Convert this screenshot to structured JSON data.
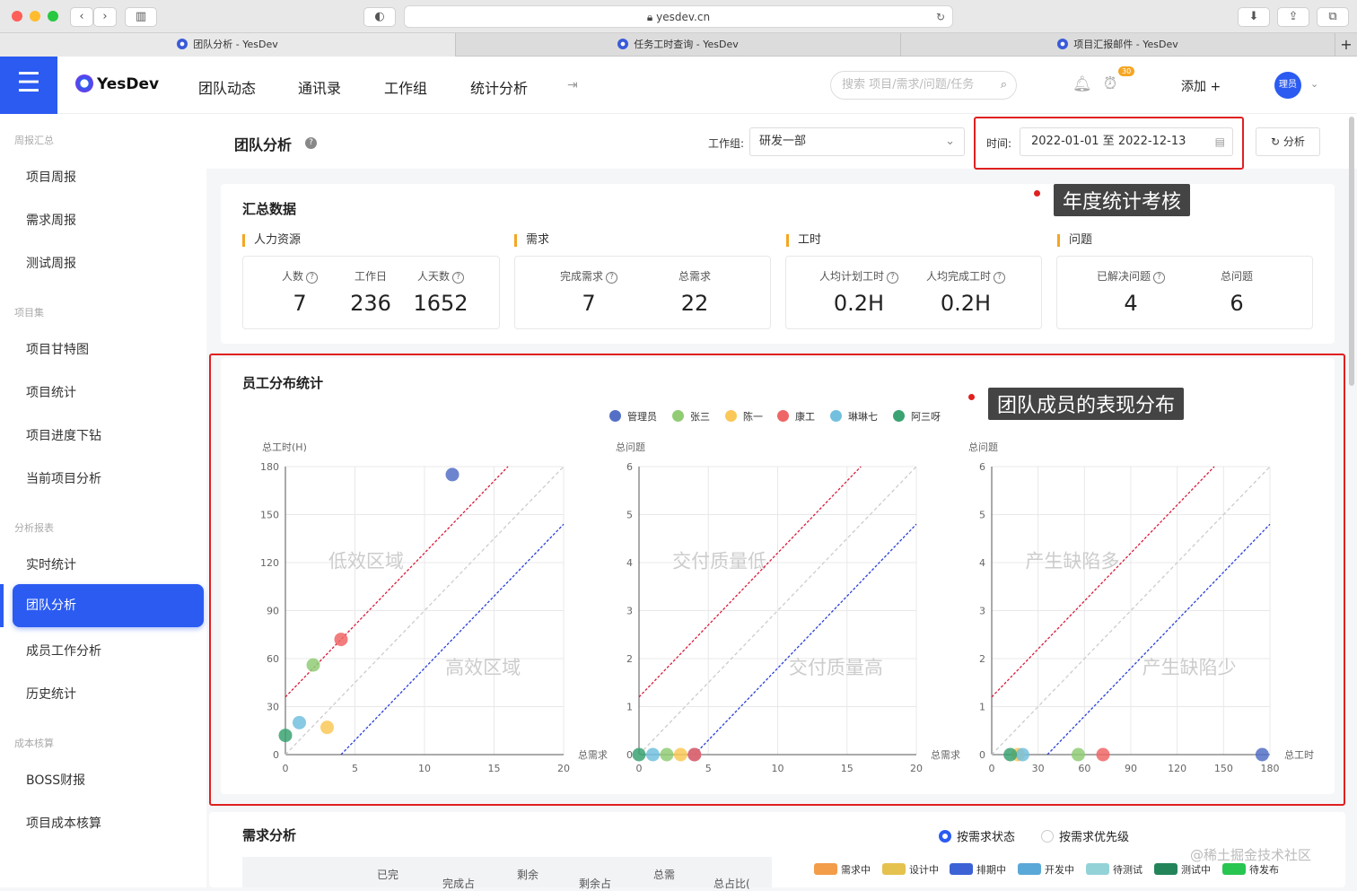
{
  "browser": {
    "url": "yesdev.cn",
    "tabs": [
      "团队分析 - YesDev",
      "任务工时查询 - YesDev",
      "项目汇报邮件 - YesDev"
    ]
  },
  "topnav": {
    "brand": "YesDev",
    "items": [
      "团队动态",
      "通讯录",
      "工作组",
      "统计分析"
    ],
    "search_placeholder": "搜索 项目/需求/问题/任务",
    "badge": "30",
    "add": "添加 +",
    "avatar": "理员"
  },
  "sidebar": {
    "groups": [
      "周报汇总",
      "项目集",
      "分析报表",
      "成本核算"
    ],
    "items": [
      "项目周报",
      "需求周报",
      "测试周报",
      "项目甘特图",
      "项目统计",
      "项目进度下钻",
      "当前项目分析",
      "实时统计",
      "团队分析",
      "成员工作分析",
      "历史统计",
      "BOSS财报",
      "项目成本核算"
    ]
  },
  "header": {
    "title": "团队分析",
    "group_label": "工作组:",
    "group_value": "研发一部",
    "time_label": "时间:",
    "time_value": "2022-01-01 至 2022-12-13",
    "analyze": "分析"
  },
  "callouts": {
    "annual": "年度统计考核",
    "team": "团队成员的表现分布"
  },
  "summary": {
    "title": "汇总数据",
    "sections": [
      "人力资源",
      "需求",
      "工时",
      "问题"
    ],
    "stats": [
      {
        "label": "人数",
        "value": "7"
      },
      {
        "label": "工作日",
        "value": "236"
      },
      {
        "label": "人天数",
        "value": "1652"
      },
      {
        "label": "完成需求",
        "value": "7"
      },
      {
        "label": "总需求",
        "value": "22"
      },
      {
        "label": "人均计划工时",
        "value": "0.2H"
      },
      {
        "label": "人均完成工时",
        "value": "0.2H"
      },
      {
        "label": "已解决问题",
        "value": "4"
      },
      {
        "label": "总问题",
        "value": "6"
      }
    ]
  },
  "distribution": {
    "title": "员工分布统计"
  },
  "demand": {
    "title": "需求分析",
    "radio1": "按需求状态",
    "radio2": "按需求优先级",
    "table_headers": [
      "已完",
      "完成占",
      "剩余",
      "剩余占",
      "总需",
      "总占比("
    ],
    "legend": [
      {
        "name": "需求中",
        "color": "#f39c4a"
      },
      {
        "name": "设计中",
        "color": "#e5c14e"
      },
      {
        "name": "排期中",
        "color": "#3c62d6"
      },
      {
        "name": "开发中",
        "color": "#5aa8d8"
      },
      {
        "name": "待测试",
        "color": "#93d3d8"
      },
      {
        "name": "测试中",
        "color": "#23845a"
      },
      {
        "name": "待发布",
        "color": "#27c650"
      }
    ]
  },
  "watermark": "@稀土掘金技术社区",
  "chart_data": [
    {
      "type": "scatter",
      "ylabel": "总工时(H)",
      "xlabel": "总需求",
      "xlim": [
        0,
        20
      ],
      "ylim": [
        0,
        180
      ],
      "xticks": [
        0,
        5,
        10,
        15,
        20
      ],
      "yticks": [
        0,
        30,
        60,
        90,
        120,
        150,
        180
      ],
      "zone_upper": "低效区域",
      "zone_lower": "高效区域",
      "series": [
        {
          "name": "管理员",
          "color": "#5470c6",
          "x": 12,
          "y": 175
        },
        {
          "name": "张三",
          "color": "#91cc75",
          "x": 2,
          "y": 56
        },
        {
          "name": "陈一",
          "color": "#fac858",
          "x": 3,
          "y": 17
        },
        {
          "name": "康工",
          "color": "#ee6666",
          "x": 4,
          "y": 72
        },
        {
          "name": "琳琳七",
          "color": "#73c0de",
          "x": 1,
          "y": 20
        },
        {
          "name": "阿三呀",
          "color": "#3ba272",
          "x": 0,
          "y": 12
        }
      ],
      "lines": {
        "upper": [
          [
            0,
            36
          ],
          [
            16,
            180
          ]
        ],
        "mid": [
          [
            0,
            0
          ],
          [
            20,
            180
          ]
        ],
        "lower": [
          [
            4,
            0
          ],
          [
            20,
            144
          ]
        ]
      }
    },
    {
      "type": "scatter",
      "ylabel": "总问题",
      "xlabel": "总需求",
      "xlim": [
        0,
        20
      ],
      "ylim": [
        0,
        6
      ],
      "xticks": [
        0,
        5,
        10,
        15,
        20
      ],
      "yticks": [
        0,
        1,
        2,
        3,
        4,
        5,
        6
      ],
      "zone_upper": "交付质量低",
      "zone_lower": "交付质量高",
      "series": [
        {
          "name": "管理员",
          "color": "#5470c6",
          "x": 4,
          "y": 0
        },
        {
          "name": "张三",
          "color": "#91cc75",
          "x": 2,
          "y": 0
        },
        {
          "name": "陈一",
          "color": "#fac858",
          "x": 3,
          "y": 0
        },
        {
          "name": "康工",
          "color": "#ee6666",
          "x": 4,
          "y": 0
        },
        {
          "name": "琳琳七",
          "color": "#73c0de",
          "x": 1,
          "y": 0
        },
        {
          "name": "阿三呀",
          "color": "#3ba272",
          "x": 0,
          "y": 0
        }
      ],
      "lines": {
        "upper": [
          [
            0,
            1.2
          ],
          [
            16,
            6
          ]
        ],
        "mid": [
          [
            0,
            0
          ],
          [
            20,
            6
          ]
        ],
        "lower": [
          [
            4,
            0
          ],
          [
            20,
            4.8
          ]
        ]
      }
    },
    {
      "type": "scatter",
      "ylabel": "总问题",
      "xlabel": "总工时",
      "xlim": [
        0,
        180
      ],
      "ylim": [
        0,
        6
      ],
      "xticks": [
        0,
        30,
        60,
        90,
        120,
        150,
        180
      ],
      "yticks": [
        0,
        1,
        2,
        3,
        4,
        5,
        6
      ],
      "zone_upper": "产生缺陷多",
      "zone_lower": "产生缺陷少",
      "series": [
        {
          "name": "管理员",
          "color": "#5470c6",
          "x": 175,
          "y": 0
        },
        {
          "name": "张三",
          "color": "#91cc75",
          "x": 56,
          "y": 0
        },
        {
          "name": "陈一",
          "color": "#fac858",
          "x": 17,
          "y": 0
        },
        {
          "name": "康工",
          "color": "#ee6666",
          "x": 72,
          "y": 0
        },
        {
          "name": "琳琳七",
          "color": "#73c0de",
          "x": 20,
          "y": 0
        },
        {
          "name": "阿三呀",
          "color": "#3ba272",
          "x": 12,
          "y": 0
        }
      ],
      "lines": {
        "upper": [
          [
            0,
            1.2
          ],
          [
            144,
            6
          ]
        ],
        "mid": [
          [
            0,
            0
          ],
          [
            180,
            6
          ]
        ],
        "lower": [
          [
            36,
            0
          ],
          [
            180,
            4.8
          ]
        ]
      }
    }
  ]
}
